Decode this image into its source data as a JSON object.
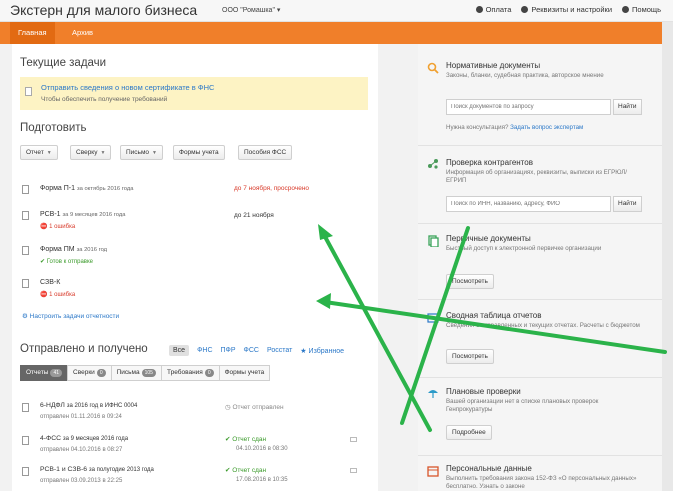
{
  "header": {
    "app_title": "Экстерн для малого бизнеса",
    "org": "ООО \"Ромашка\" ▾",
    "links": [
      "Оплата",
      "Реквизиты и настройки",
      "Помощь"
    ]
  },
  "nav": {
    "main": "Главная",
    "archive": "Архив"
  },
  "current_tasks": {
    "title": "Текущие задачи",
    "link": "Отправить сведения о новом сертификате в ФНС",
    "sub": "Чтобы обеспечить получение требований"
  },
  "prepare": {
    "title": "Подготовить",
    "buttons": [
      "Отчет",
      "Сверку",
      "Письмо",
      "Формы учета",
      "Пособия ФСС"
    ],
    "reports": [
      {
        "name": "Форма П-1",
        "period": "за октябрь 2016 года",
        "status": "",
        "deadline": "до 7 ноября, просрочено"
      },
      {
        "name": "РСВ-1",
        "period": "за 9 месяцев 2016 года",
        "status": "1 ошибка",
        "deadline": "до 21 ноября"
      },
      {
        "name": "Форма ПМ",
        "period": "за 2016 год",
        "status": "Готов к отправке",
        "deadline": ""
      },
      {
        "name": "СЗВ-К",
        "period": "",
        "status": "1 ошибка",
        "deadline": ""
      }
    ],
    "setup_link": "Настроить задачи отчетности"
  },
  "sent": {
    "title": "Отправлено и получено",
    "filters": [
      "Все",
      "ФНС",
      "ПФР",
      "ФСС",
      "Росстат",
      "Избранное"
    ],
    "subtabs": [
      {
        "label": "Отчеты",
        "count": "41"
      },
      {
        "label": "Сверки",
        "count": "0"
      },
      {
        "label": "Письма",
        "count": "105"
      },
      {
        "label": "Требования",
        "count": "0"
      },
      {
        "label": "Формы учета",
        "count": ""
      }
    ],
    "items": [
      {
        "name": "6-НДФЛ",
        "period": "за 2016 год в ИФНС 0004",
        "sent": "отправлен 01.11.2016 в 09:24",
        "status": "Отчет отправлен",
        "status_date": ""
      },
      {
        "name": "4-ФСС",
        "period": "за 9 месяцев 2016 года",
        "sent": "отправлен 04.10.2016 в 08:27",
        "status": "Отчет сдан",
        "status_date": "04.10.2016 в 08:30"
      },
      {
        "name": "РСВ-1 и СЗВ-6",
        "period": "за полугодие 2013 года",
        "sent": "отправлен 03.09.2013 в 22:25",
        "status": "Отчет сдан",
        "status_date": "17.08.2016 в 10:35"
      }
    ]
  },
  "sidebar": {
    "norm": {
      "title": "Нормативные документы",
      "desc": "Законы, бланки, судебная практика, авторское мнение",
      "placeholder": "Поиск документов по запросу",
      "button": "Найти",
      "consult": "Нужна консультация?",
      "consult_link": "Задать вопрос экспертам"
    },
    "check": {
      "title": "Проверка контрагентов",
      "desc": "Информация об организациях, реквизиты, выписки из ЕГРЮЛ/ЕГРИП",
      "placeholder": "Поиск по ИНН, названию, адресу, ФИО",
      "button": "Найти"
    },
    "primary": {
      "title": "Первичные документы",
      "desc": "Быстрый доступ к электронной первичке организации",
      "button": "Посмотреть"
    },
    "summary": {
      "title": "Сводная таблица отчетов",
      "desc": "Сведения о отправленных и текущих отчетах. Расчеты с бюджетом",
      "button": "Посмотреть"
    },
    "inspections": {
      "title": "Плановые проверки",
      "desc": "Вашей организации нет в списке плановых проверок Генпрокуратуры",
      "button": "Подробнее"
    },
    "personal": {
      "title": "Персональные данные",
      "desc": "Выполнить требования закона 152-ФЗ «О персональных данных» бесплатно. Узнать о законе"
    }
  },
  "colors": {
    "accent": "#f07f2a",
    "link": "#2b78c8",
    "error": "#d83a2a",
    "ok": "#3a9a2a",
    "arrow": "#2bb34a"
  }
}
